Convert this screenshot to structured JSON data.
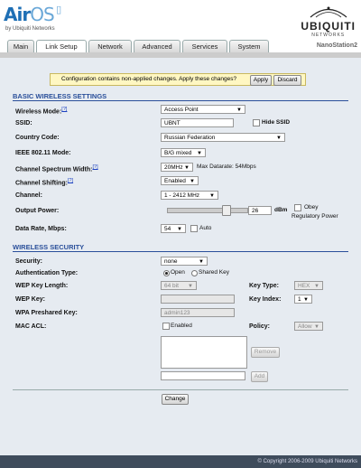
{
  "brand": {
    "logo_text": "AirOS",
    "logo_sub": "by Ubiquiti Networks",
    "vendor": "UBIQUITI",
    "vendor_sub": "NETWORKS"
  },
  "tabs": [
    {
      "label": "Main"
    },
    {
      "label": "Link Setup"
    },
    {
      "label": "Network"
    },
    {
      "label": "Advanced"
    },
    {
      "label": "Services"
    },
    {
      "label": "System"
    }
  ],
  "device_name": "NanoStation2",
  "notice": {
    "text": "Configuration contains non-applied changes. Apply these changes?",
    "apply": "Apply",
    "discard": "Discard"
  },
  "basic": {
    "title": "BASIC WIRELESS SETTINGS",
    "wireless_mode": {
      "label": "Wireless Mode:",
      "help": "[?]",
      "value": "Access Point"
    },
    "ssid": {
      "label": "SSID:",
      "value": "UBNT",
      "hide_label": "Hide SSID"
    },
    "country": {
      "label": "Country Code:",
      "value": "Russian Federation"
    },
    "ieee": {
      "label": "IEEE 802.11 Mode:",
      "value": "B/G mixed"
    },
    "spectrum": {
      "label": "Channel Spectrum Width:",
      "help": "[?]",
      "value": "20MHz",
      "datarate": "Max Datarate: 54Mbps"
    },
    "shifting": {
      "label": "Channel Shifting:",
      "help": "[?]",
      "value": "Enabled"
    },
    "channel": {
      "label": "Channel:",
      "value": "1 - 2412 MHz"
    },
    "power": {
      "label": "Output Power:",
      "value": "26",
      "unit": "dBm",
      "obey": "Obey",
      "regulatory": "Regulatory Power"
    },
    "rate": {
      "label": "Data Rate, Mbps:",
      "value": "54",
      "auto": "Auto"
    }
  },
  "security": {
    "title": "WIRELESS SECURITY",
    "security": {
      "label": "Security:",
      "value": "none"
    },
    "auth": {
      "label": "Authentication Type:",
      "open": "Open",
      "shared": "Shared Key"
    },
    "wep_len": {
      "label": "WEP Key Length:",
      "value": "64 bit"
    },
    "key_type": {
      "label": "Key Type:",
      "value": "HEX"
    },
    "wep_key": {
      "label": "WEP Key:",
      "value": ""
    },
    "key_index": {
      "label": "Key Index:",
      "value": "1"
    },
    "wpa": {
      "label": "WPA Preshared Key:",
      "value": "admin123"
    },
    "mac_acl": {
      "label": "MAC ACL:",
      "enabled": "Enabled"
    },
    "policy": {
      "label": "Policy:",
      "value": "Allow"
    },
    "remove": "Remove",
    "add": "Add"
  },
  "change_button": "Change",
  "footer": "© Copyright 2006-2009 Ubiquiti Networks"
}
